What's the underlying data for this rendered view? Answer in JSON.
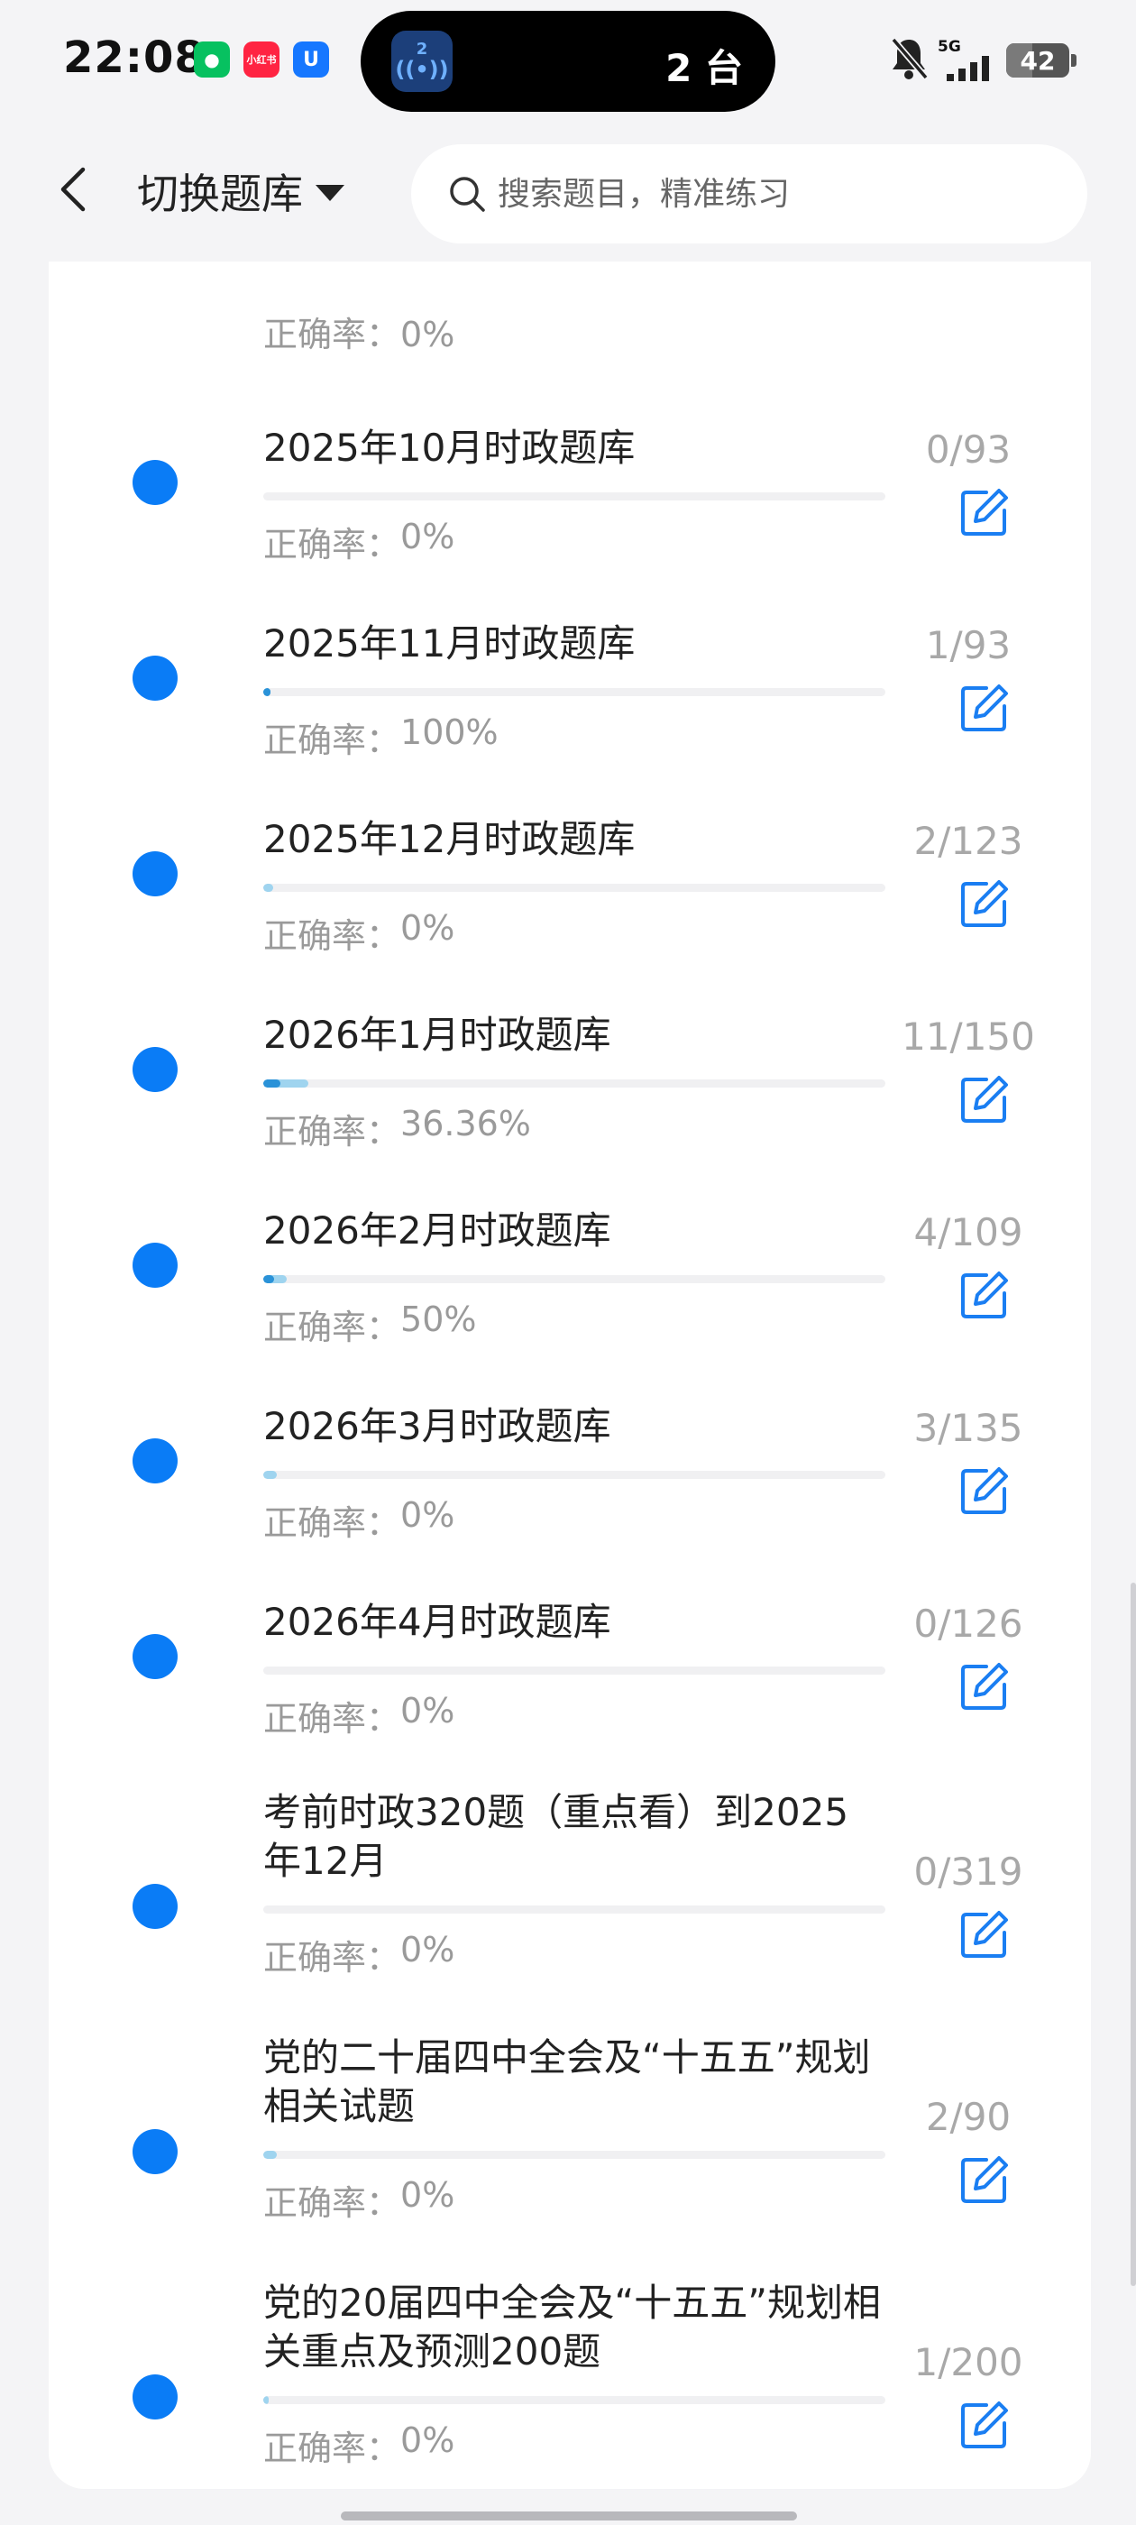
{
  "status_bar": {
    "time": "22:08",
    "apps": [
      {
        "name": "wechat-icon",
        "glyph": "●",
        "color": "#07c160"
      },
      {
        "name": "xiaohongshu-icon",
        "glyph": "小红书",
        "color": "#ff2442"
      },
      {
        "name": "u-app-icon",
        "glyph": "U",
        "color": "#1677ff"
      }
    ],
    "island": {
      "badge": "2",
      "label": "2 台"
    },
    "network": "5G",
    "battery": "42"
  },
  "nav": {
    "bank_switch_label": "切换题库",
    "search_placeholder": "搜索题目，精准练习"
  },
  "accuracy_prefix": "正确率：",
  "partial_row": {
    "accuracy": "0%"
  },
  "banks": [
    {
      "title": "2025年10月时政题库",
      "accuracy": "0%",
      "count": "0/93",
      "progress": 0.0,
      "answered": 0.0
    },
    {
      "title": "2025年11月时政题库",
      "accuracy": "100%",
      "count": "1/93",
      "progress": 0.011,
      "answered": 0.011
    },
    {
      "title": "2025年12月时政题库",
      "accuracy": "0%",
      "count": "2/123",
      "progress": 0.0,
      "answered": 0.016
    },
    {
      "title": "2026年1月时政题库",
      "accuracy": "36.36%",
      "count": "11/150",
      "progress": 0.027,
      "answered": 0.073
    },
    {
      "title": "2026年2月时政题库",
      "accuracy": "50%",
      "count": "4/109",
      "progress": 0.018,
      "answered": 0.037
    },
    {
      "title": "2026年3月时政题库",
      "accuracy": "0%",
      "count": "3/135",
      "progress": 0.0,
      "answered": 0.022
    },
    {
      "title": "2026年4月时政题库",
      "accuracy": "0%",
      "count": "0/126",
      "progress": 0.0,
      "answered": 0.0
    },
    {
      "title": "考前时政320题（重点看）到2025年12月",
      "accuracy": "0%",
      "count": "0/319",
      "progress": 0.0,
      "answered": 0.0
    },
    {
      "title": "党的二十届四中全会及“十五五”规划相关试题",
      "accuracy": "0%",
      "count": "2/90",
      "progress": 0.0,
      "answered": 0.022
    },
    {
      "title": "党的20届四中全会及“十五五”规划相关重点及预测200题",
      "accuracy": "0%",
      "count": "1/200",
      "progress": 0.0,
      "answered": 0.005
    }
  ]
}
